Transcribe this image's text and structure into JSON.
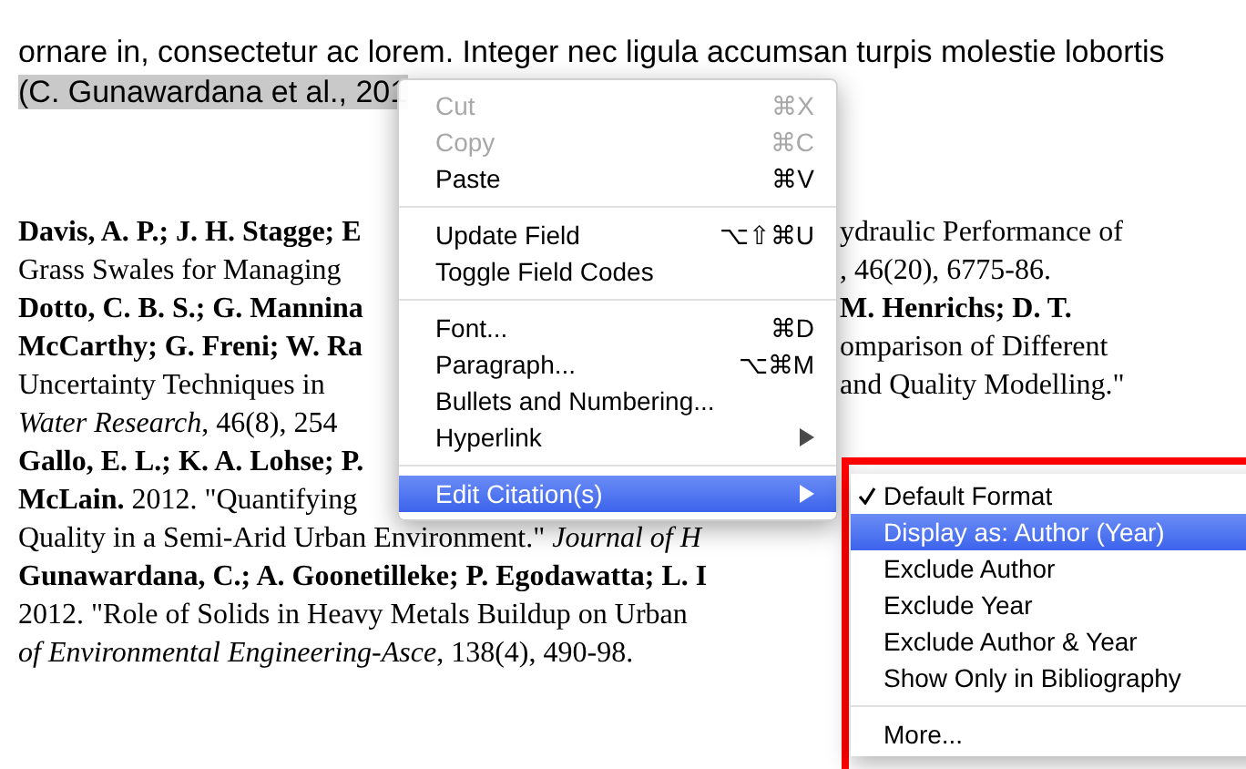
{
  "body_lines": [
    "ornare in, consectetur ac lorem. Integer nec ligula accumsan turpis molestie lobortis"
  ],
  "citation": {
    "text": "(C. Gunawardana et al., 201",
    "selected": true
  },
  "bibliography": [
    {
      "left": "**Davis, A. P.; J. H. Stagge; E**",
      "right": "ydraulic Performance of"
    },
    {
      "left": "Grass Swales for Managing",
      "right": ", 46(20), 6775-86."
    },
    {
      "left": "**Dotto, C. B. S.; G. Mannina**",
      "right": "**M. Henrichs; D. T.**"
    },
    {
      "left": "**McCarthy; G. Freni; W. Ra**",
      "right": "omparison of Different"
    },
    {
      "left": "Uncertainty Techniques in",
      "right": "and Quality Modelling.\""
    },
    {
      "left": "*Water Research*, 46(8), 254"
    },
    {
      "left": "**Gallo, E. L.; K. A. Lohse; P.**"
    },
    {
      "left": "**McLain.** 2012. \"Quantifying"
    },
    {
      "left": "Quality in a Semi-Arid Urban Environment.\" *Journal of H*"
    },
    {
      "left": "**Gunawardana, C.; A. Goonetilleke; P. Egodawatta; L. I**"
    },
    {
      "left": "2012. \"Role of Solids in Heavy Metals Buildup on Urban"
    },
    {
      "left": "*of Environmental Engineering-Asce*, 138(4), 490-98."
    }
  ],
  "context_menu": [
    {
      "kind": "item",
      "label": "Cut",
      "shortcut": "⌘X",
      "disabled": true,
      "selected": false,
      "submenu": false
    },
    {
      "kind": "item",
      "label": "Copy",
      "shortcut": "⌘C",
      "disabled": true,
      "selected": false,
      "submenu": false
    },
    {
      "kind": "item",
      "label": "Paste",
      "shortcut": "⌘V",
      "disabled": false,
      "selected": false,
      "submenu": false
    },
    {
      "kind": "separator"
    },
    {
      "kind": "item",
      "label": "Update Field",
      "shortcut": "⌥⇧⌘U",
      "disabled": false,
      "selected": false,
      "submenu": false
    },
    {
      "kind": "item",
      "label": "Toggle Field Codes",
      "disabled": false,
      "selected": false,
      "submenu": false
    },
    {
      "kind": "separator"
    },
    {
      "kind": "item",
      "label": "Font...",
      "shortcut": "⌘D",
      "disabled": false,
      "selected": false,
      "submenu": false
    },
    {
      "kind": "item",
      "label": "Paragraph...",
      "shortcut": "⌥⌘M",
      "disabled": false,
      "selected": false,
      "submenu": false
    },
    {
      "kind": "item",
      "label": "Bullets and Numbering...",
      "disabled": false,
      "selected": false,
      "submenu": false
    },
    {
      "kind": "item",
      "label": "Hyperlink",
      "disabled": false,
      "selected": false,
      "submenu": true
    },
    {
      "kind": "separator"
    },
    {
      "kind": "item",
      "label": "Edit Citation(s)",
      "disabled": false,
      "selected": true,
      "submenu": true
    }
  ],
  "submenu": [
    {
      "kind": "item",
      "label": "Default Format",
      "checked": true,
      "selected": false
    },
    {
      "kind": "item",
      "label": "Display as: Author (Year)",
      "checked": false,
      "selected": true
    },
    {
      "kind": "item",
      "label": "Exclude Author",
      "checked": false,
      "selected": false
    },
    {
      "kind": "item",
      "label": "Exclude Year",
      "checked": false,
      "selected": false
    },
    {
      "kind": "item",
      "label": "Exclude Author & Year",
      "checked": false,
      "selected": false
    },
    {
      "kind": "item",
      "label": "Show Only in Bibliography",
      "checked": false,
      "selected": false
    },
    {
      "kind": "separator"
    },
    {
      "kind": "item",
      "label": "More...",
      "checked": false,
      "selected": false
    }
  ]
}
